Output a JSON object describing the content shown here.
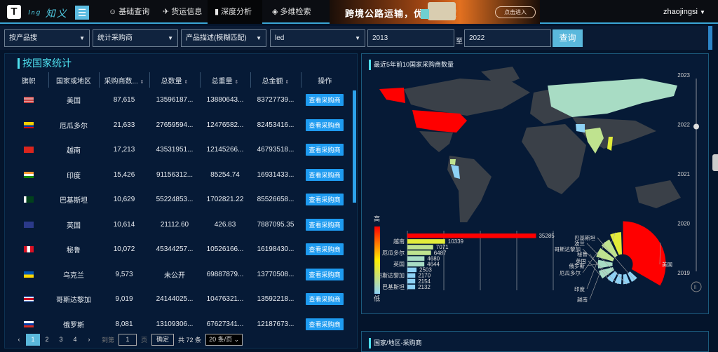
{
  "header": {
    "logo_glyph": "T",
    "brand": "ᴵⁿᵍ 知义",
    "nav": [
      "基础查询",
      "货运信息",
      "深度分析",
      "多维检索"
    ],
    "nav_icons": [
      "user-search-icon",
      "plane-icon",
      "chart-icon",
      "eye-icon"
    ],
    "banner_text": "跨境公路运输，优价来袭！",
    "banner_button": "点击进入",
    "user": "zhaojingsi"
  },
  "filters": {
    "search_mode": "按产品搜",
    "stat_type": "统计采购商",
    "match_mode": "产品描述(模糊匹配)",
    "keyword": "led",
    "year_from": "2013",
    "to_label": "至",
    "year_to": "2022",
    "query_button": "查询"
  },
  "left": {
    "title": "按国家统计",
    "columns": [
      "旗帜",
      "国家或地区",
      "采购商数...",
      "总数量",
      "总重量",
      "总金额",
      "操作"
    ],
    "rows": [
      {
        "flag": "us",
        "country": "美国",
        "buyers": "87,615",
        "qty": "13596187...",
        "weight": "13880643...",
        "amount": "83727739..."
      },
      {
        "flag": "ec",
        "country": "厄瓜多尔",
        "buyers": "21,633",
        "qty": "27659594...",
        "weight": "12476582...",
        "amount": "82453416..."
      },
      {
        "flag": "vn",
        "country": "越南",
        "buyers": "17,213",
        "qty": "43531951...",
        "weight": "12145266...",
        "amount": "46793518..."
      },
      {
        "flag": "in",
        "country": "印度",
        "buyers": "15,426",
        "qty": "91156312...",
        "weight": "85254.74",
        "amount": "16931433..."
      },
      {
        "flag": "pk",
        "country": "巴基斯坦",
        "buyers": "10,629",
        "qty": "55224853...",
        "weight": "1702821.22",
        "amount": "85526658..."
      },
      {
        "flag": "gb",
        "country": "英国",
        "buyers": "10,614",
        "qty": "21112.60",
        "weight": "426.83",
        "amount": "7887095.35"
      },
      {
        "flag": "pe",
        "country": "秘鲁",
        "buyers": "10,072",
        "qty": "45344257...",
        "weight": "10526166...",
        "amount": "16198430..."
      },
      {
        "flag": "ua",
        "country": "乌克兰",
        "buyers": "9,573",
        "qty": "未公开",
        "weight": "69887879...",
        "amount": "13770508..."
      },
      {
        "flag": "cr",
        "country": "哥斯达黎加",
        "buyers": "9,019",
        "qty": "24144025...",
        "weight": "10476321...",
        "amount": "13592218..."
      },
      {
        "flag": "ru",
        "country": "俄罗斯",
        "buyers": "8,081",
        "qty": "13109306...",
        "weight": "67627341...",
        "amount": "12187673..."
      }
    ],
    "action_label": "查看采购商",
    "pager": {
      "pages": [
        "1",
        "2",
        "3",
        "4"
      ],
      "current": "1",
      "goto_label": "到第",
      "goto_value": "1",
      "page_unit": "页",
      "confirm": "确定",
      "total": "共 72 条",
      "page_size": "20 条/页"
    }
  },
  "map_panel": {
    "title": "最近5年前10国家采购商数量",
    "legend_high": "高",
    "legend_low": "低",
    "timeline": [
      "2023",
      "2022",
      "2021",
      "2020",
      "2019"
    ],
    "timeline_current": "2022"
  },
  "chart_data": {
    "type": "bar",
    "title": "最近5年前10国家采购商数量",
    "categories": [
      "美国",
      "越南",
      "印度",
      "厄瓜多尔",
      "俄罗斯",
      "英国",
      "秘鲁",
      "哥斯达黎加",
      "波兰",
      "巴基斯坦"
    ],
    "shown_bar_labels": [
      "",
      "越南",
      "",
      "厄瓜多尔",
      "",
      "英国",
      "",
      "哥斯达黎加",
      "",
      "巴基斯坦"
    ],
    "values": [
      35285,
      10339,
      7071,
      6487,
      4680,
      4644,
      2503,
      2170,
      2154,
      2132
    ],
    "xlim": [
      0,
      40000
    ],
    "colors": [
      "#ff0000",
      "#e2ec3a",
      "#bfe38f",
      "#bfe38f",
      "#a8dcc4",
      "#a8dcc4",
      "#8ed2f5",
      "#8ed2f5",
      "#8ed2f5",
      "#8ed2f5"
    ]
  },
  "bottom_panel": {
    "title": "国家/地区-采购商"
  },
  "colors": {
    "accent": "#4ee0ee",
    "button": "#1e9bf0",
    "query": "#5ab8dc"
  }
}
